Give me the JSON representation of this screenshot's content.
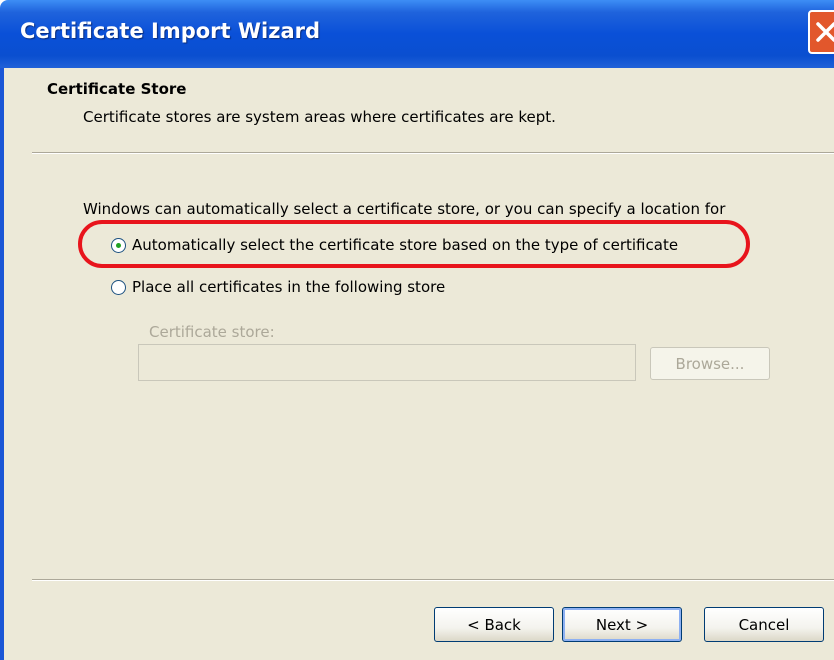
{
  "window": {
    "title": "Certificate Import Wizard"
  },
  "header": {
    "title": "Certificate Store",
    "subtitle": "Certificate stores are system areas where certificates are kept."
  },
  "body": {
    "intro": "Windows can automatically select a certificate store, or you can specify a location for",
    "options": [
      {
        "label": "Automatically select the certificate store based on the type of certificate",
        "selected": true
      },
      {
        "label": "Place all certificates in the following store",
        "selected": false
      }
    ],
    "store_label": "Certificate store:",
    "store_value": "",
    "browse_label": "Browse..."
  },
  "footer": {
    "back_label": "< Back",
    "next_label": "Next >",
    "cancel_label": "Cancel"
  },
  "annotation": {
    "highlight_color": "#e8141c"
  }
}
